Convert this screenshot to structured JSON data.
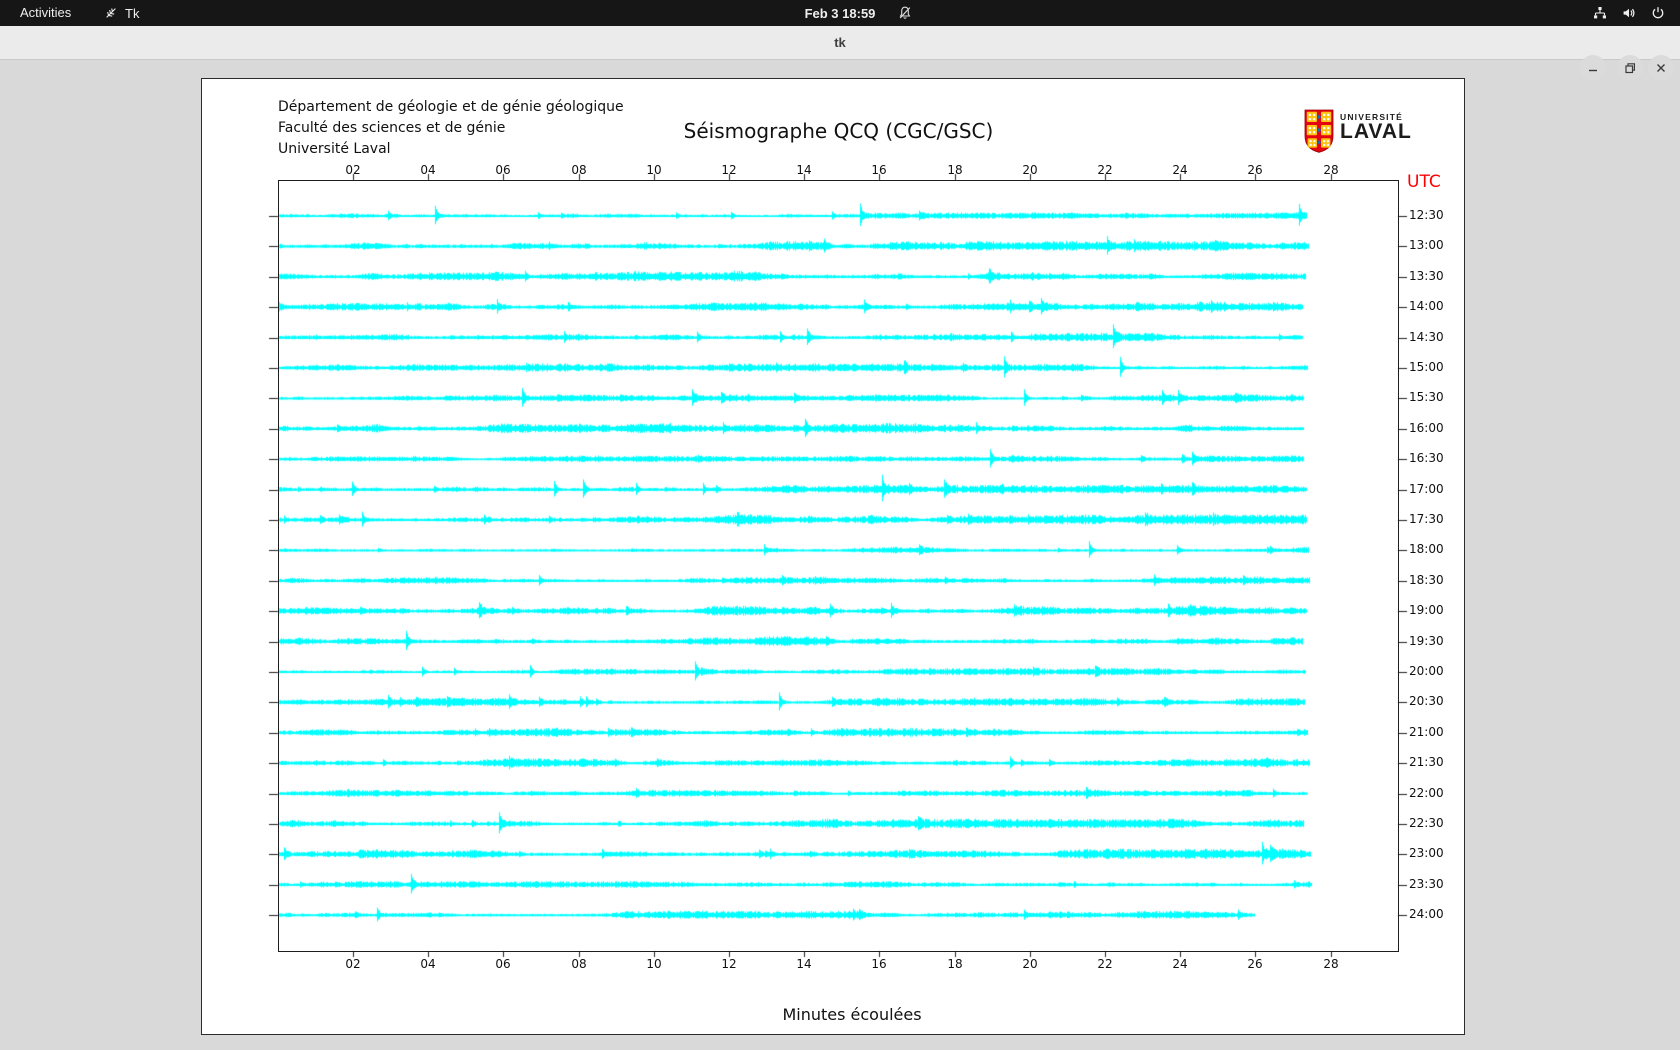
{
  "top_bar": {
    "activities_label": "Activities",
    "app_indicator": "Tk",
    "clock": "Feb 3 18:59",
    "status_icons": [
      "network-wired",
      "volume",
      "power"
    ]
  },
  "window": {
    "title": "tk",
    "controls": [
      "minimize",
      "maximize",
      "close"
    ]
  },
  "canvas": {
    "header_lines": [
      "Département de géologie et de génie géologique",
      "Faculté des sciences et de génie",
      "Université Laval"
    ],
    "title": "Séismographe QCQ (CGC/GSC)",
    "logo": {
      "small_text": "UNIVERSITÉ",
      "large_text": "LAVAL"
    }
  },
  "plot": {
    "utc_label": "UTC",
    "utc_color": "#ff0000",
    "xlabel": "Minutes écoulées",
    "x_ticks": [
      "02",
      "04",
      "06",
      "08",
      "10",
      "12",
      "14",
      "16",
      "18",
      "20",
      "22",
      "24",
      "26",
      "28"
    ],
    "row_labels": [
      "12:30",
      "13:00",
      "13:30",
      "14:00",
      "14:30",
      "15:00",
      "15:30",
      "16:00",
      "16:30",
      "17:00",
      "17:30",
      "18:00",
      "18:30",
      "19:00",
      "19:30",
      "20:00",
      "20:30",
      "21:00",
      "21:30",
      "22:00",
      "22:30",
      "23:00",
      "23:30",
      "24:00"
    ],
    "trace_color": "#00ffff"
  },
  "chart_data": {
    "type": "line",
    "subtype": "helicorder_seismogram",
    "title": "Séismographe QCQ (CGC/GSC)",
    "station": "QCQ (CGC/GSC)",
    "xlabel": "Minutes écoulées",
    "x_tick_labels": [
      "02",
      "04",
      "06",
      "08",
      "10",
      "12",
      "14",
      "16",
      "18",
      "20",
      "22",
      "24",
      "26",
      "28"
    ],
    "x_range_minutes": [
      0,
      30
    ],
    "right_axis_title": "UTC",
    "rows": 24,
    "minutes_per_row": 30,
    "row_start_times_utc": [
      "12:30",
      "13:00",
      "13:30",
      "14:00",
      "14:30",
      "15:00",
      "15:30",
      "16:00",
      "16:30",
      "17:00",
      "17:30",
      "18:00",
      "18:30",
      "19:00",
      "19:30",
      "20:00",
      "20:30",
      "21:00",
      "21:30",
      "22:00",
      "22:30",
      "23:00",
      "23:30",
      "24:00"
    ],
    "trace_color": "#00ffff",
    "content": "Continuous ambient seismic background noise on every half-hour line with intermittent small spikes/bursts; no large earthquake signature visible; the final line (24:00) is truncated near minute 26 (recording in progress).",
    "grid": false,
    "legend": null
  }
}
